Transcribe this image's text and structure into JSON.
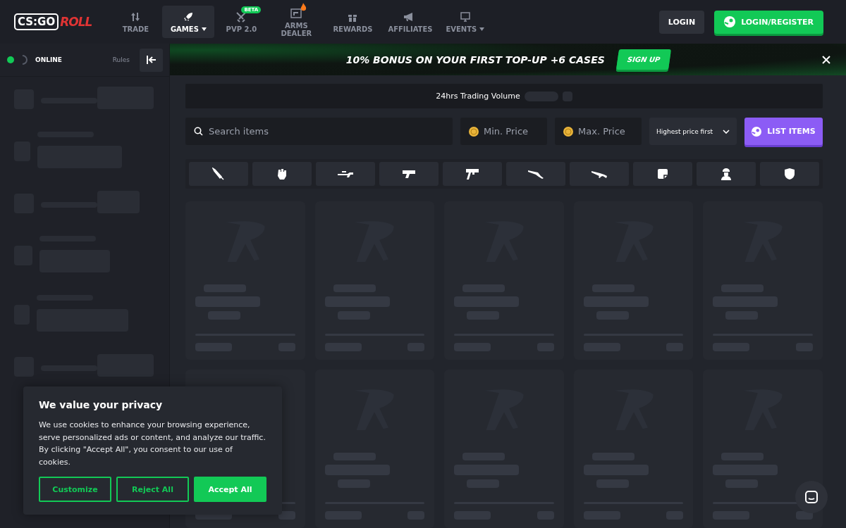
{
  "header": {
    "logo": {
      "part1": "CS:GO",
      "part2": "ROLL"
    },
    "nav": [
      {
        "label": "TRADE",
        "selected": false,
        "dropdown": false,
        "hot": false
      },
      {
        "label": "GAMES",
        "selected": true,
        "dropdown": true,
        "hot": false
      },
      {
        "label": "PVP 2.0",
        "selected": false,
        "dropdown": false,
        "hot": false,
        "badge": "BETA"
      },
      {
        "label": "ARMS DEALER",
        "selected": false,
        "dropdown": false,
        "hot": true
      },
      {
        "label": "REWARDS",
        "selected": false,
        "dropdown": false,
        "hot": false
      },
      {
        "label": "AFFILIATES",
        "selected": false,
        "dropdown": false,
        "hot": false
      },
      {
        "label": "EVENTS",
        "selected": false,
        "dropdown": true,
        "hot": false
      }
    ],
    "login": "LOGIN",
    "register": "LOGIN/REGISTER"
  },
  "sidebar": {
    "status": {
      "label": "ONLINE",
      "on": true
    },
    "rules": "Rules"
  },
  "banner": {
    "text": "10% BONUS ON YOUR FIRST TOP-UP +6 CASES",
    "button": "SIGN UP"
  },
  "trading_volume": {
    "label": "24hrs Trading Volume"
  },
  "filters": {
    "search": {
      "placeholder": "Search items"
    },
    "min_price": {
      "placeholder": "Min. Price"
    },
    "max_price": {
      "placeholder": "Max. Price"
    },
    "sort": "Highest price first",
    "list_button": "LIST ITEMS"
  },
  "cookie_dialog": {
    "title": "We value your privacy",
    "text": "We use cookies to enhance your browsing experience, serve personalized ads or content, and analyze our traffic. By clicking \"Accept All\", you consent to our use of cookies.",
    "buttons": [
      {
        "label": "Customize",
        "kind": "outline"
      },
      {
        "label": "Reject All",
        "kind": "outline"
      },
      {
        "label": "Accept All",
        "kind": "filled"
      }
    ]
  }
}
